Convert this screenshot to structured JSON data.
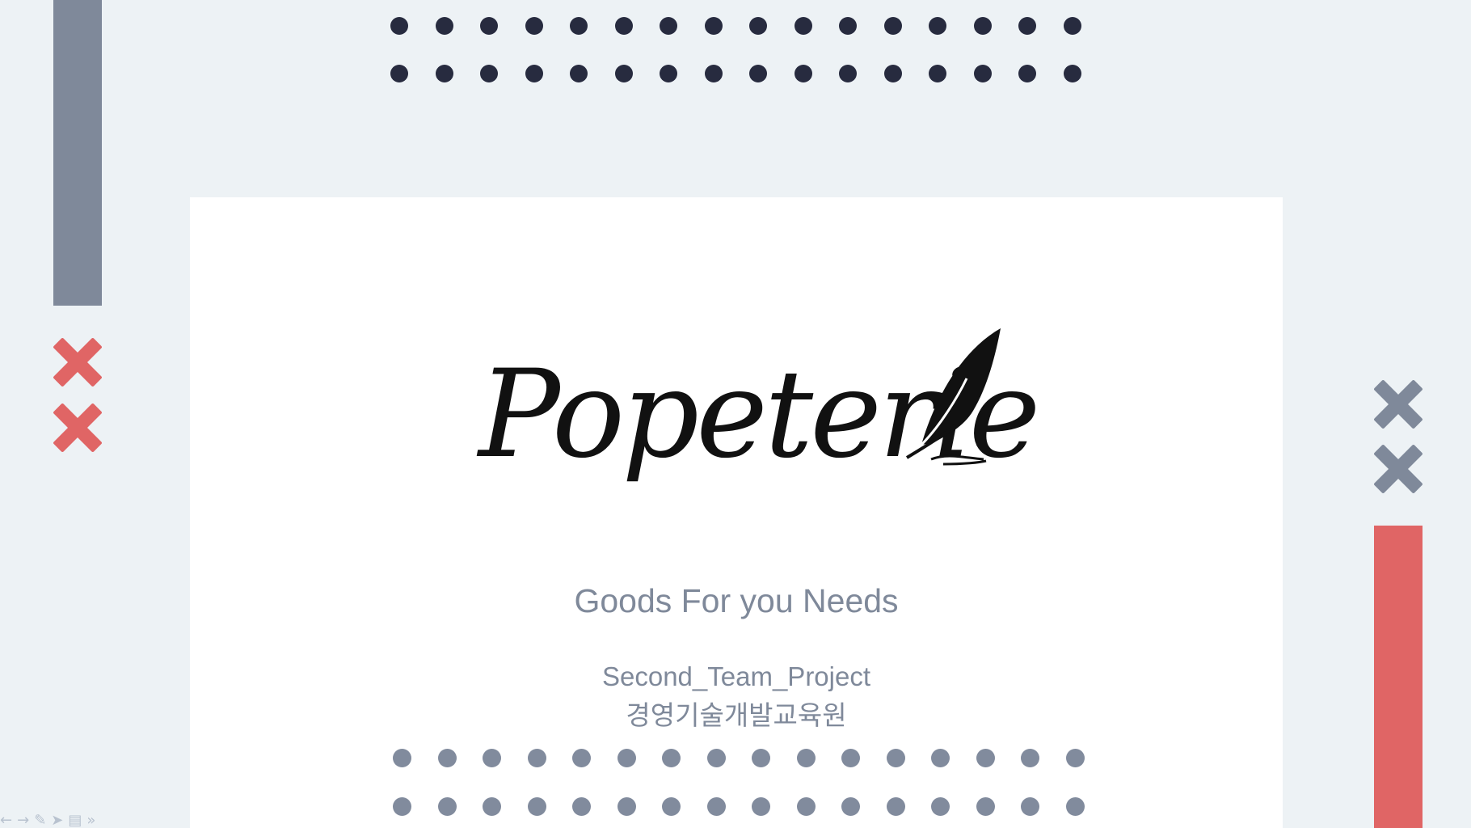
{
  "slide": {
    "logo_text": "Popeterie",
    "tagline": "Goods For you Needs",
    "project_name": "Second_Team_Project",
    "organization": "경영기술개발교육원"
  },
  "decor": {
    "dark_dot_color": "#272b3f",
    "grey_dot_color": "#818b9d",
    "red_accent": "#e06565",
    "grey_accent": "#7f899a",
    "left_x_icon_count": 2,
    "right_x_icon_count": 2,
    "dot_columns": 16,
    "dot_rows_per_group": 2
  },
  "presentation_toolbar": {
    "icons": [
      "back-arrow-icon",
      "forward-arrow-icon",
      "pen-icon",
      "pointer-icon",
      "slides-icon",
      "more-icon"
    ]
  }
}
